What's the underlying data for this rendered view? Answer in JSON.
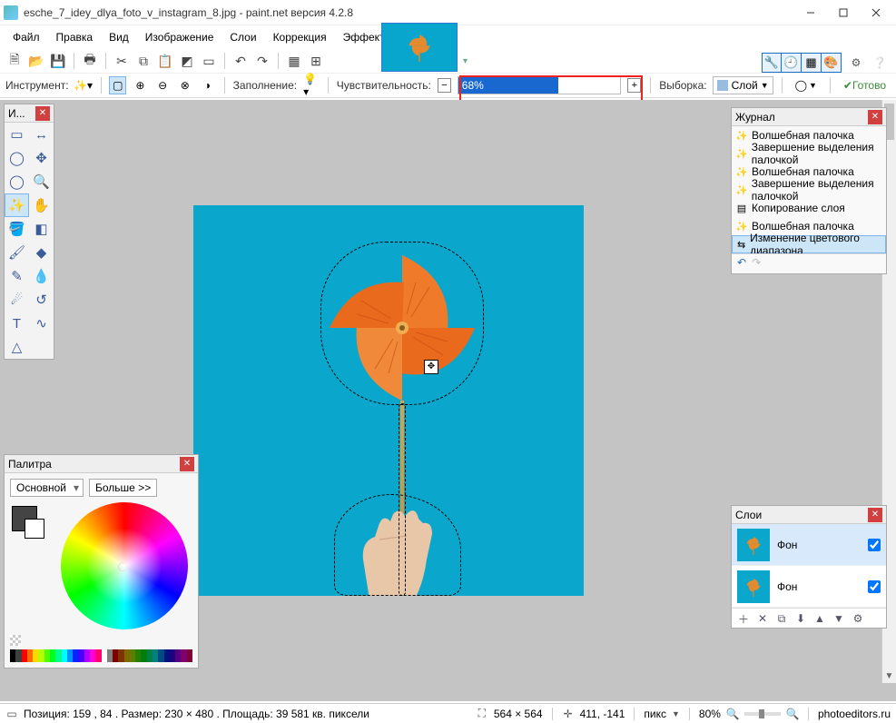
{
  "titlebar": {
    "filename": "esche_7_idey_dlya_foto_v_instagram_8.jpg",
    "app": "paint.net версия 4.2.8"
  },
  "menu": [
    "Файл",
    "Правка",
    "Вид",
    "Изображение",
    "Слои",
    "Коррекция",
    "Эффекты"
  ],
  "options": {
    "instrument_label": "Инструмент:",
    "fill_label": "Заполнение:",
    "tolerance_label": "Чувствительность:",
    "tolerance_value": "68%",
    "sample_label": "Выборка:",
    "sample_value": "Слой",
    "finish_label": "Готово"
  },
  "tools_panel": {
    "title": "И..."
  },
  "colors_panel": {
    "title": "Палитра",
    "mode": "Основной",
    "more": "Больше >>",
    "palette": [
      "#000000",
      "#404040",
      "#ff0000",
      "#ff6a00",
      "#ffd800",
      "#b6ff00",
      "#4cff00",
      "#00ff21",
      "#00ff90",
      "#00ffff",
      "#0094ff",
      "#0026ff",
      "#4800ff",
      "#b200ff",
      "#ff00dc",
      "#ff006e",
      "#ffffff",
      "#808080",
      "#7f0000",
      "#7f3300",
      "#7f6a00",
      "#5b7f00",
      "#267f00",
      "#007f0e",
      "#007f46",
      "#007f7f",
      "#004a7f",
      "#00137f",
      "#21007f",
      "#57007f",
      "#7f006e",
      "#7f0037"
    ]
  },
  "history_panel": {
    "title": "Журнал",
    "items": [
      {
        "icon": "wand",
        "label": "Волшебная палочка"
      },
      {
        "icon": "wand",
        "label": "Завершение выделения палочкой"
      },
      {
        "icon": "wand",
        "label": "Волшебная палочка"
      },
      {
        "icon": "wand",
        "label": "Завершение выделения палочкой"
      },
      {
        "icon": "layer",
        "label": "Копирование слоя"
      },
      {
        "icon": "wand",
        "label": "Волшебная палочка"
      },
      {
        "icon": "slider",
        "label": "Изменение цветового диапазона"
      }
    ]
  },
  "layers_panel": {
    "title": "Слои",
    "layers": [
      {
        "name": "Фон",
        "visible": true,
        "selected": true
      },
      {
        "name": "Фон",
        "visible": true,
        "selected": false
      }
    ]
  },
  "statusbar": {
    "selection": "Позиция: 159 , 84 . Размер: 230  × 480 . Площадь: 39 581 кв. пиксели",
    "canvas_size": "564 × 564",
    "cursor": "411, -141",
    "units": "пикс",
    "zoom": "80%",
    "website": "photoeditors.ru"
  }
}
